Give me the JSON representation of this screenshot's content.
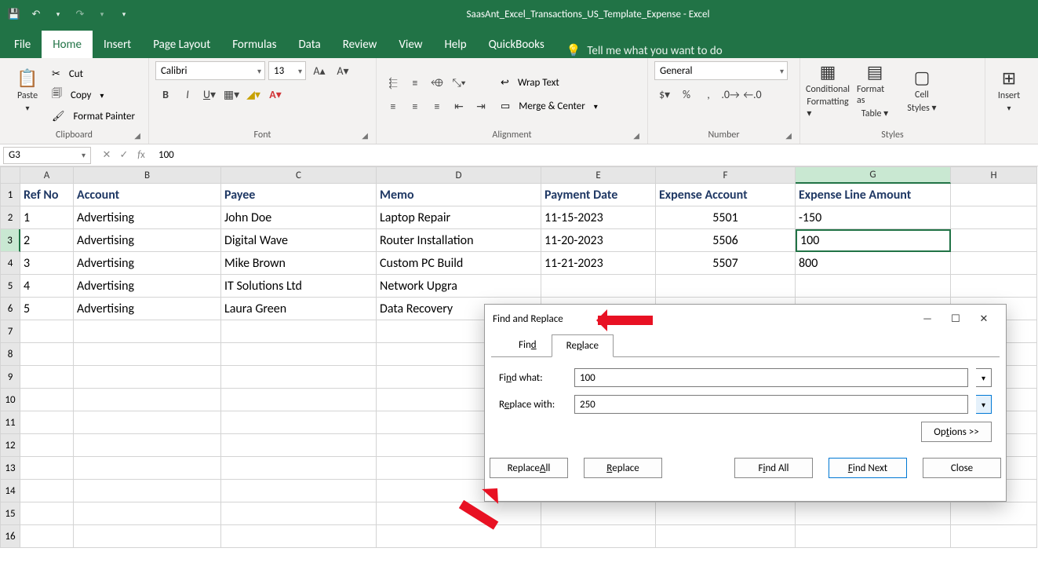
{
  "app": {
    "title": "SaasAnt_Excel_Transactions_US_Template_Expense  -  Excel"
  },
  "menu": {
    "file": "File",
    "home": "Home",
    "insert": "Insert",
    "pagelayout": "Page Layout",
    "formulas": "Formulas",
    "data": "Data",
    "review": "Review",
    "view": "View",
    "help": "Help",
    "quickbooks": "QuickBooks",
    "tellme": "Tell me what you want to do"
  },
  "ribbon": {
    "paste": "Paste",
    "cut": "Cut",
    "copy": "Copy",
    "formatpainter": "Format Painter",
    "clipboard": "Clipboard",
    "font": "Font",
    "font_name": "Calibri",
    "font_size": "13",
    "alignment": "Alignment",
    "wraptext": "Wrap Text",
    "mergecenter": "Merge & Center",
    "number": "Number",
    "number_fmt": "General",
    "styles": "Styles",
    "condfmt": "Conditional",
    "condfmt2": "Formatting",
    "fmttable": "Format as",
    "fmttable2": "Table",
    "cellstyles": "Cell",
    "cellstyles2": "Styles",
    "insert": "Insert"
  },
  "namebox": "G3",
  "formula": "100",
  "cols": [
    "A",
    "B",
    "C",
    "D",
    "E",
    "F",
    "G",
    "H"
  ],
  "headers": {
    "A": "Ref No",
    "B": "Account",
    "C": "Payee",
    "D": "Memo",
    "E": "Payment Date",
    "F": "Expense Account",
    "G": "Expense Line Amount"
  },
  "rows": [
    {
      "A": "1",
      "B": "Advertising",
      "C": "John Doe",
      "D": "Laptop Repair",
      "E": "11-15-2023",
      "F": "5501",
      "G": "-150"
    },
    {
      "A": "2",
      "B": "Advertising",
      "C": "Digital Wave",
      "D": "Router Installation",
      "E": "11-20-2023",
      "F": "5506",
      "G": "100"
    },
    {
      "A": "3",
      "B": "Advertising",
      "C": "Mike Brown",
      "D": "Custom PC Build",
      "E": "11-21-2023",
      "F": "5507",
      "G": "800"
    },
    {
      "A": "4",
      "B": "Advertising",
      "C": "IT Solutions Ltd",
      "D": "Network Upgra",
      "E": "",
      "F": "",
      "G": ""
    },
    {
      "A": "5",
      "B": "Advertising",
      "C": "Laura Green",
      "D": "Data Recovery",
      "E": "",
      "F": "",
      "G": ""
    }
  ],
  "dlg": {
    "title": "Find and Replace",
    "tab_find": "Find",
    "tab_replace": "Replace",
    "find_label": "Find what:",
    "find_val": "100",
    "repl_label": "Replace with:",
    "repl_val": "250",
    "options": "Options >>",
    "replace_all": "Replace All",
    "replace": "Replace",
    "find_all": "Find All",
    "find_next": "Find Next",
    "close": "Close"
  },
  "active_cell": "G3"
}
